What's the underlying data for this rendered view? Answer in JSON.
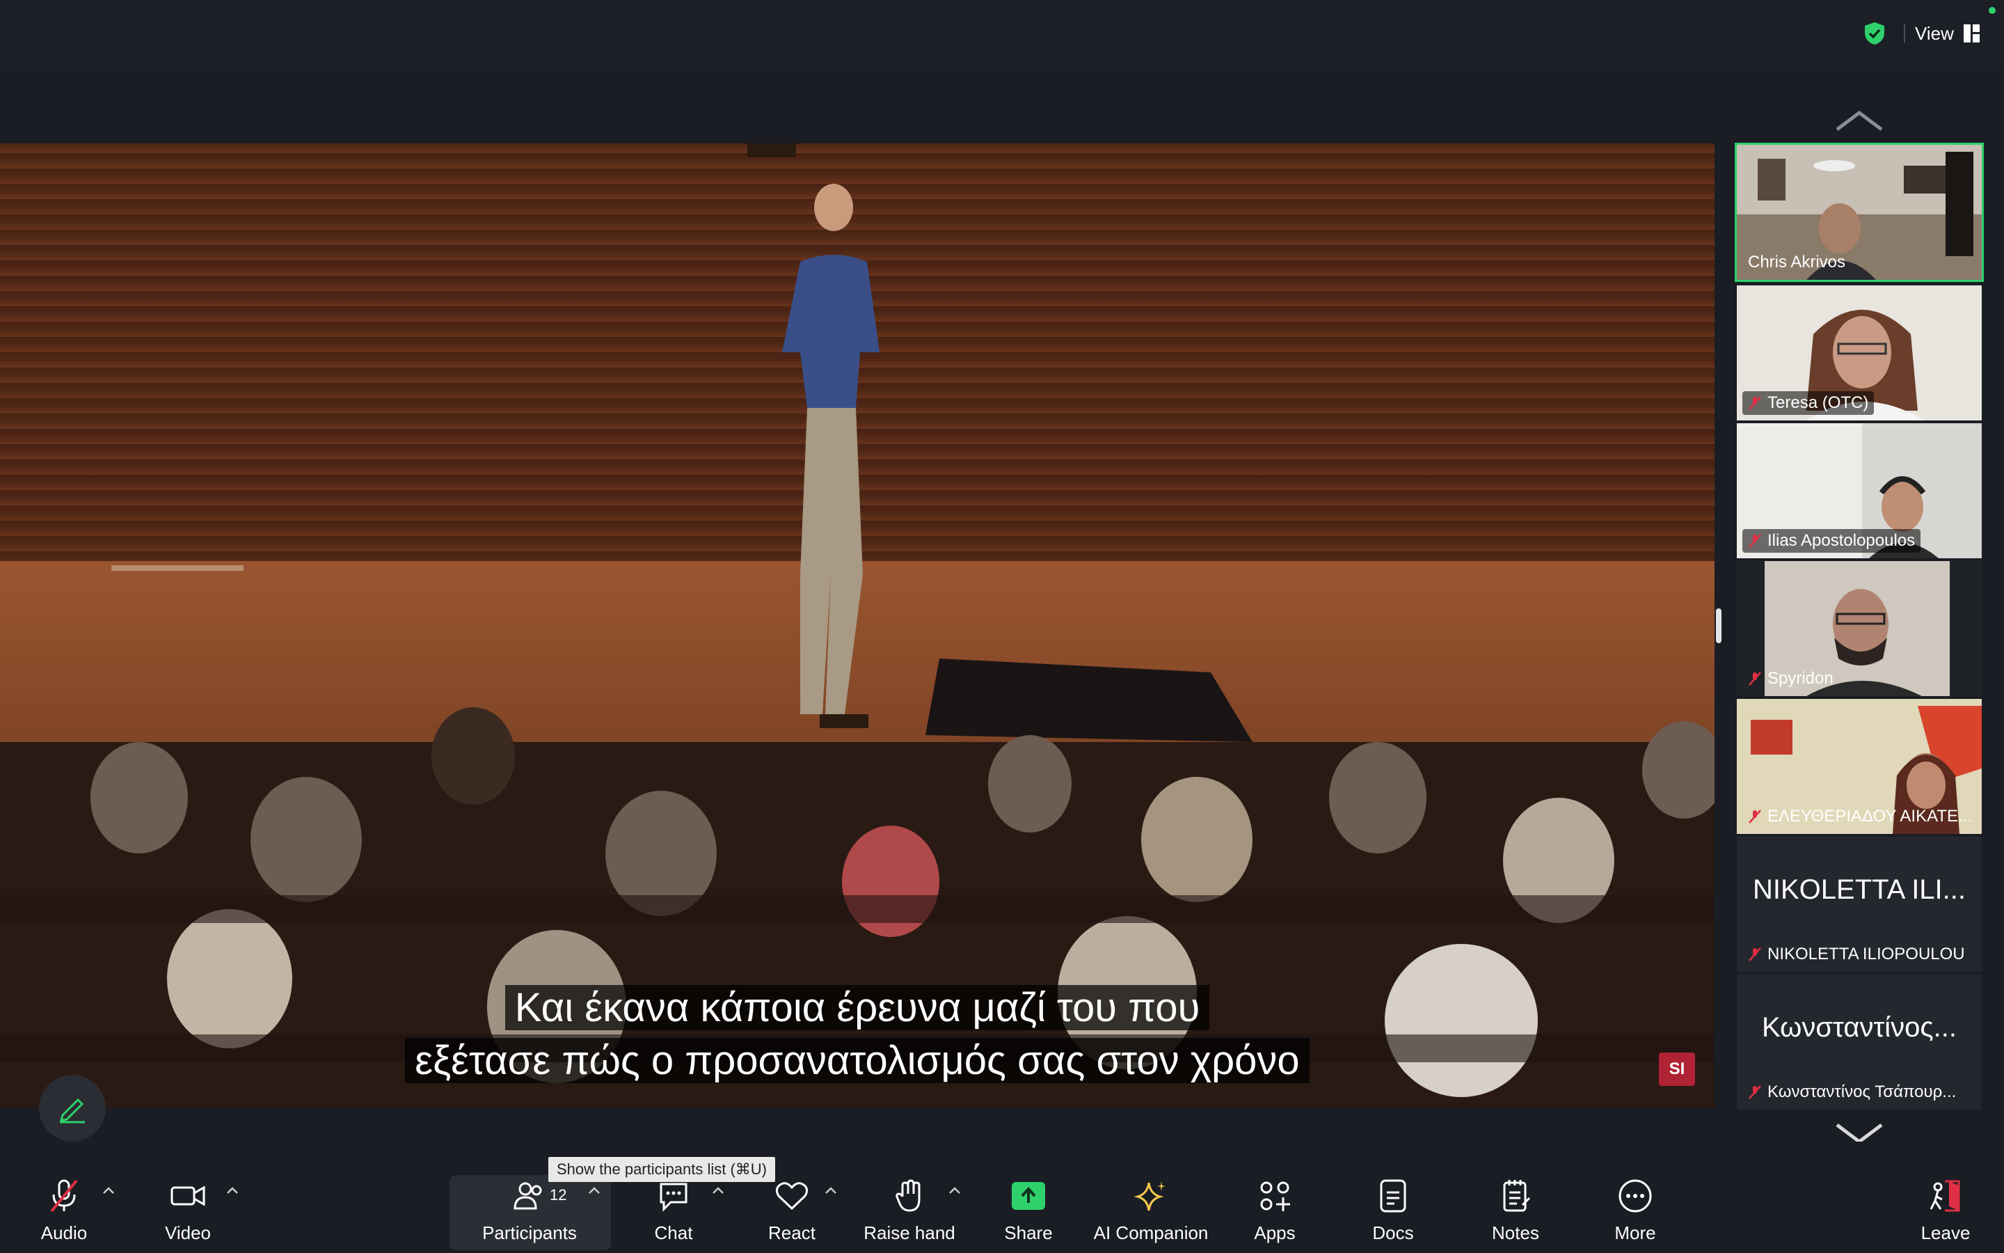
{
  "top_bar": {
    "view_label": "View",
    "security_icon": "shield-check-icon",
    "status_color": "#2ed16b"
  },
  "main_video": {
    "caption_line1": "Και έκανα κάποια έρευνα μαζί του που",
    "caption_line2": "εξέτασε πώς ο προσανατολισμός σας στον χρόνο",
    "logo_text": "SI"
  },
  "gallery": {
    "tiles": [
      {
        "name": "Chris Akrivos",
        "muted": false,
        "active": true
      },
      {
        "name": "Teresa (OTC)",
        "muted": true,
        "active": false
      },
      {
        "name": "Ilias Apostolopoulos",
        "muted": true,
        "active": false
      },
      {
        "name": "Spyridon",
        "muted": true,
        "active": false
      },
      {
        "name": "ΕΛΕΥΘΕΡΙΑΔΟΥ ΑΙΚΑΤΕ...",
        "muted": true,
        "active": false
      },
      {
        "name": "NIKOLETTA ILIOPOULOU",
        "big_name": "NIKOLETTA ILI...",
        "muted": true,
        "active": false
      },
      {
        "name": "Κωνσταντίνος Τσάπουρ...",
        "big_name": "Κωνσταντίνος...",
        "muted": true,
        "active": false
      }
    ]
  },
  "tooltip": {
    "text": "Show the participants list (⌘U)"
  },
  "toolbar": {
    "audio": "Audio",
    "video": "Video",
    "participants": "Participants",
    "participants_count": "12",
    "chat": "Chat",
    "react": "React",
    "raise_hand": "Raise hand",
    "share": "Share",
    "ai_companion": "AI Companion",
    "apps": "Apps",
    "docs": "Docs",
    "notes": "Notes",
    "more": "More",
    "leave": "Leave",
    "share_color": "#2ed16b",
    "leave_color": "#e02f44",
    "ai_color": "#f5c84c",
    "muted_color": "#e02f44"
  }
}
